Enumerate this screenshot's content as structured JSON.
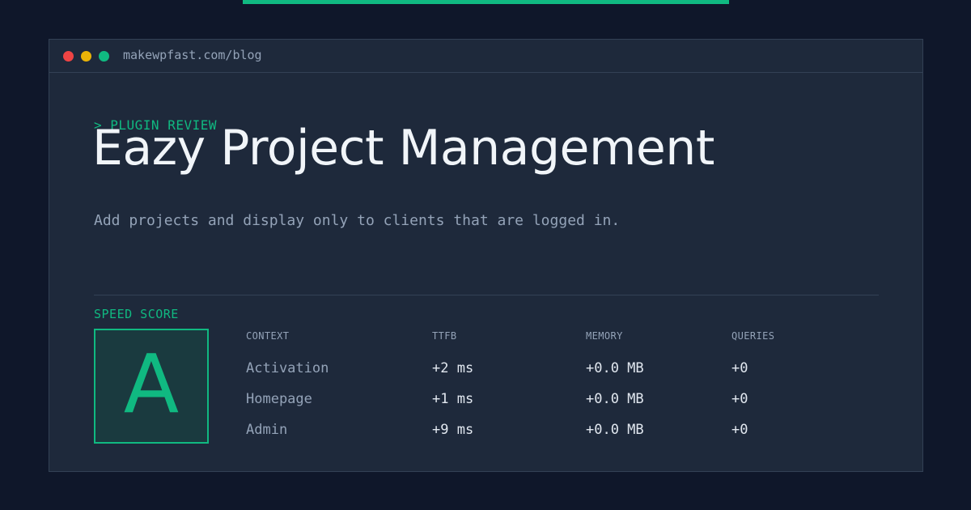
{
  "browser": {
    "url": "makewpfast.com/blog"
  },
  "header": {
    "eyebrow": "> PLUGIN REVIEW",
    "title": "Eazy Project Management",
    "subtitle": "Add projects and display only to clients that are logged in."
  },
  "score": {
    "label": "SPEED SCORE",
    "grade": "A"
  },
  "metrics": {
    "columns": [
      "CONTEXT",
      "TTFB",
      "MEMORY",
      "QUERIES"
    ],
    "rows": [
      {
        "context": "Activation",
        "ttfb": "+2 ms",
        "memory": "+0.0 MB",
        "queries": "+0"
      },
      {
        "context": "Homepage",
        "ttfb": "+1 ms",
        "memory": "+0.0 MB",
        "queries": "+0"
      },
      {
        "context": "Admin",
        "ttfb": "+9 ms",
        "memory": "+0.0 MB",
        "queries": "+0"
      }
    ]
  },
  "colors": {
    "accent": "#10b981",
    "background": "#0f172a",
    "panel": "#1e293b",
    "dot_red": "#ef4444",
    "dot_yellow": "#eab308",
    "dot_green": "#10b981"
  }
}
